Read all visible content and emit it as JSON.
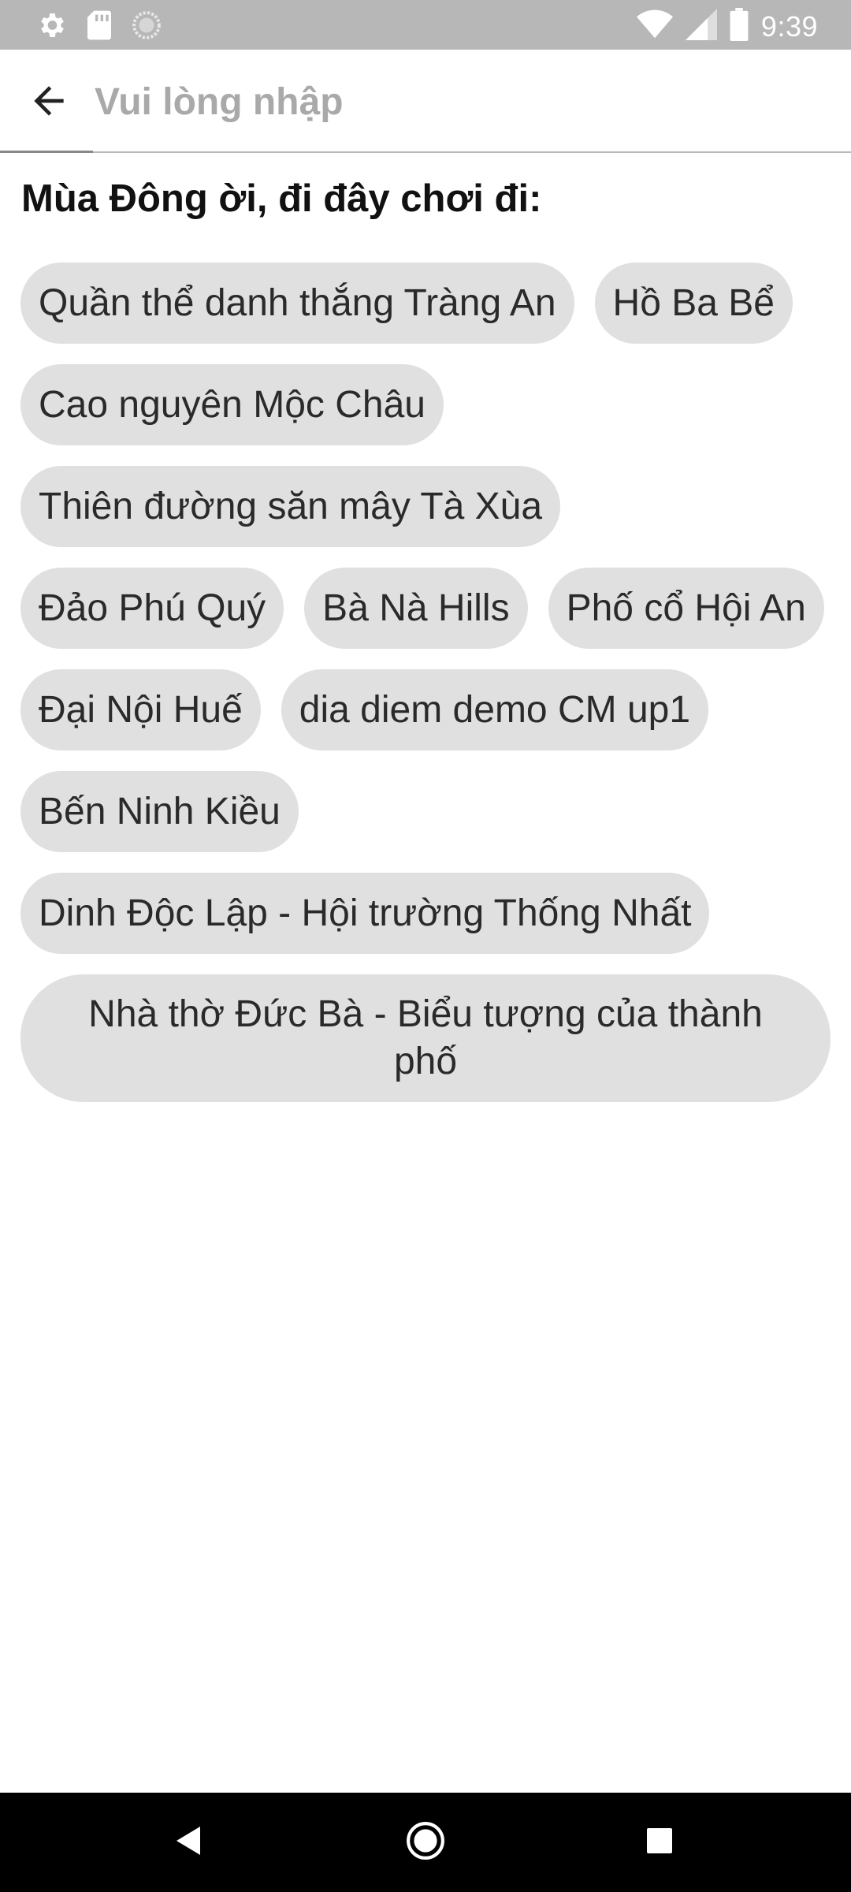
{
  "status_bar": {
    "time": "9:39",
    "left_icons": [
      "settings-icon",
      "sd-card-icon",
      "loading-circle-icon"
    ],
    "right_icons": [
      "wifi-icon",
      "signal-icon",
      "battery-icon"
    ]
  },
  "app_bar": {
    "back_icon": "arrow-back-icon",
    "search_placeholder": "Vui lòng nhập",
    "search_value": ""
  },
  "suggestions": {
    "title": "Mùa Đông ời, đi đây chơi đi:",
    "items": [
      "Quần thể danh thắng Tràng An",
      "Hồ Ba Bể",
      "Cao nguyên Mộc Châu",
      "Thiên đường săn mây Tà Xùa",
      "Đảo Phú Quý",
      "Bà Nà Hills",
      "Phố cổ Hội An",
      "Đại Nội Huế",
      "dia diem demo CM up1",
      "Bến Ninh Kiều",
      "Dinh Độc Lập - Hội trường Thống Nhất",
      "Nhà thờ Đức Bà - Biểu tượng của thành phố"
    ]
  },
  "nav_bar": {
    "buttons": [
      "back-triangle-icon",
      "home-circle-icon",
      "recents-square-icon"
    ]
  },
  "colors": {
    "status_bar_bg": "#b7b7b7",
    "chip_bg": "#e0e0e0",
    "nav_bar_bg": "#000000",
    "placeholder": "#a9a9a9"
  }
}
